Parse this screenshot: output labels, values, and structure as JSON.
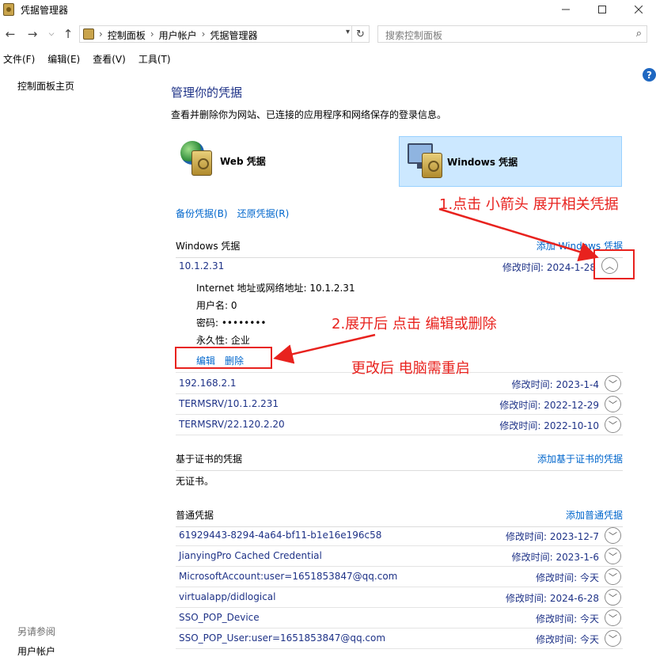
{
  "window": {
    "title": "凭据管理器",
    "min_icon": "minimize-icon",
    "max_icon": "maximize-icon",
    "close_icon": "close-icon"
  },
  "address": {
    "crumbs": [
      "控制面板",
      "用户帐户",
      "凭据管理器"
    ],
    "search_placeholder": "搜索控制面板"
  },
  "menu": [
    "文件(F)",
    "编辑(E)",
    "查看(V)",
    "工具(T)"
  ],
  "sidebar": {
    "home": "控制面板主页",
    "see_also": "另请参阅",
    "user_accounts": "用户帐户"
  },
  "help_label": "?",
  "main": {
    "title": "管理你的凭据",
    "description": "查看并删除你为网站、已连接的应用程序和网络保存的登录信息。",
    "web_tile": "Web 凭据",
    "windows_tile": "Windows 凭据",
    "backup": "备份凭据(B)",
    "restore": "还原凭据(R)"
  },
  "windows_section": {
    "title": "Windows 凭据",
    "add": "添加 Windows 凭据",
    "expanded": {
      "name": "10.1.2.31",
      "modified": "修改时间:  2024-1-28",
      "details": [
        "Internet 地址或网络地址:  10.1.2.31",
        "用户名:  0",
        "密码:  ••••••••",
        "永久性:  企业"
      ],
      "edit": "编辑",
      "delete": "删除"
    },
    "items": [
      {
        "name": "192.168.2.1",
        "modified": "修改时间:  2023-1-4"
      },
      {
        "name": "TERMSRV/10.1.2.231",
        "modified": "修改时间:  2022-12-29"
      },
      {
        "name": "TERMSRV/22.120.2.20",
        "modified": "修改时间:  2022-10-10"
      }
    ]
  },
  "cert_section": {
    "title": "基于证书的凭据",
    "add": "添加基于证书的凭据",
    "empty": "无证书。"
  },
  "generic_section": {
    "title": "普通凭据",
    "add": "添加普通凭据",
    "items": [
      {
        "name": "61929443-8294-4a64-bf11-b1e16e196c58",
        "modified": "修改时间:  2023-12-7"
      },
      {
        "name": "JianyingPro Cached Credential",
        "modified": "修改时间:  2023-1-6"
      },
      {
        "name": "MicrosoftAccount:user=1651853847@qq.com",
        "modified": "修改时间:  今天"
      },
      {
        "name": "virtualapp/didlogical",
        "modified": "修改时间:  2024-6-28"
      },
      {
        "name": "SSO_POP_Device",
        "modified": "修改时间:  今天"
      },
      {
        "name": "SSO_POP_User:user=1651853847@qq.com",
        "modified": "修改时间:  今天"
      }
    ]
  },
  "annotations": {
    "step1": "1.点击 小箭头 展开相关凭据",
    "step2": "2.展开后 点击 编辑或删除",
    "note": "更改后 电脑需重启",
    "color": "#e8221e"
  }
}
